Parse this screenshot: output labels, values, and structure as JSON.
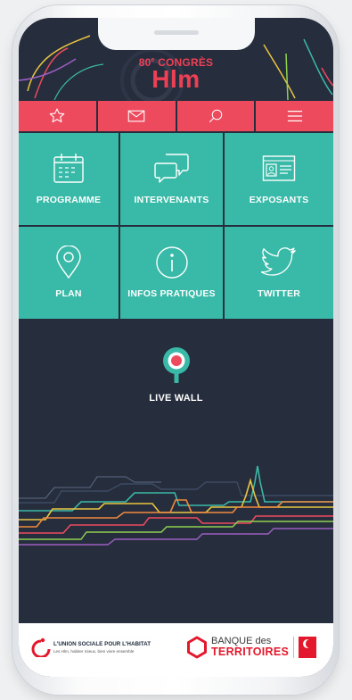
{
  "header": {
    "edition": "80",
    "edition_suffix": "e",
    "event_word": "CONGRÈS",
    "brand": "Hlm"
  },
  "tabbar": {
    "items": [
      {
        "icon": "star-icon"
      },
      {
        "icon": "mail-icon"
      },
      {
        "icon": "search-icon"
      },
      {
        "icon": "menu-icon"
      }
    ]
  },
  "tiles": [
    {
      "label": "PROGRAMME",
      "icon": "calendar-icon"
    },
    {
      "label": "INTERVENANTS",
      "icon": "chat-bubbles-icon"
    },
    {
      "label": "EXPOSANTS",
      "icon": "id-card-icon"
    },
    {
      "label": "PLAN",
      "icon": "map-pin-icon"
    },
    {
      "label": "INFOS PRATIQUES",
      "icon": "info-icon"
    },
    {
      "label": "TWITTER",
      "icon": "twitter-bird-icon"
    }
  ],
  "live_wall": {
    "label": "LIVE WALL"
  },
  "footer": {
    "ush_title": "L'UNION SOCIALE POUR L'HABITAT",
    "ush_tagline": "Les Hlm, habiter mieux, bien vivre ensemble",
    "bdt_line1": "BANQUE des",
    "bdt_line2": "TERRITOIRES"
  },
  "colors": {
    "background": "#262d3d",
    "accent_red": "#ee4a5e",
    "tile_teal": "#39b9a7",
    "logo_red": "#ee4055"
  }
}
